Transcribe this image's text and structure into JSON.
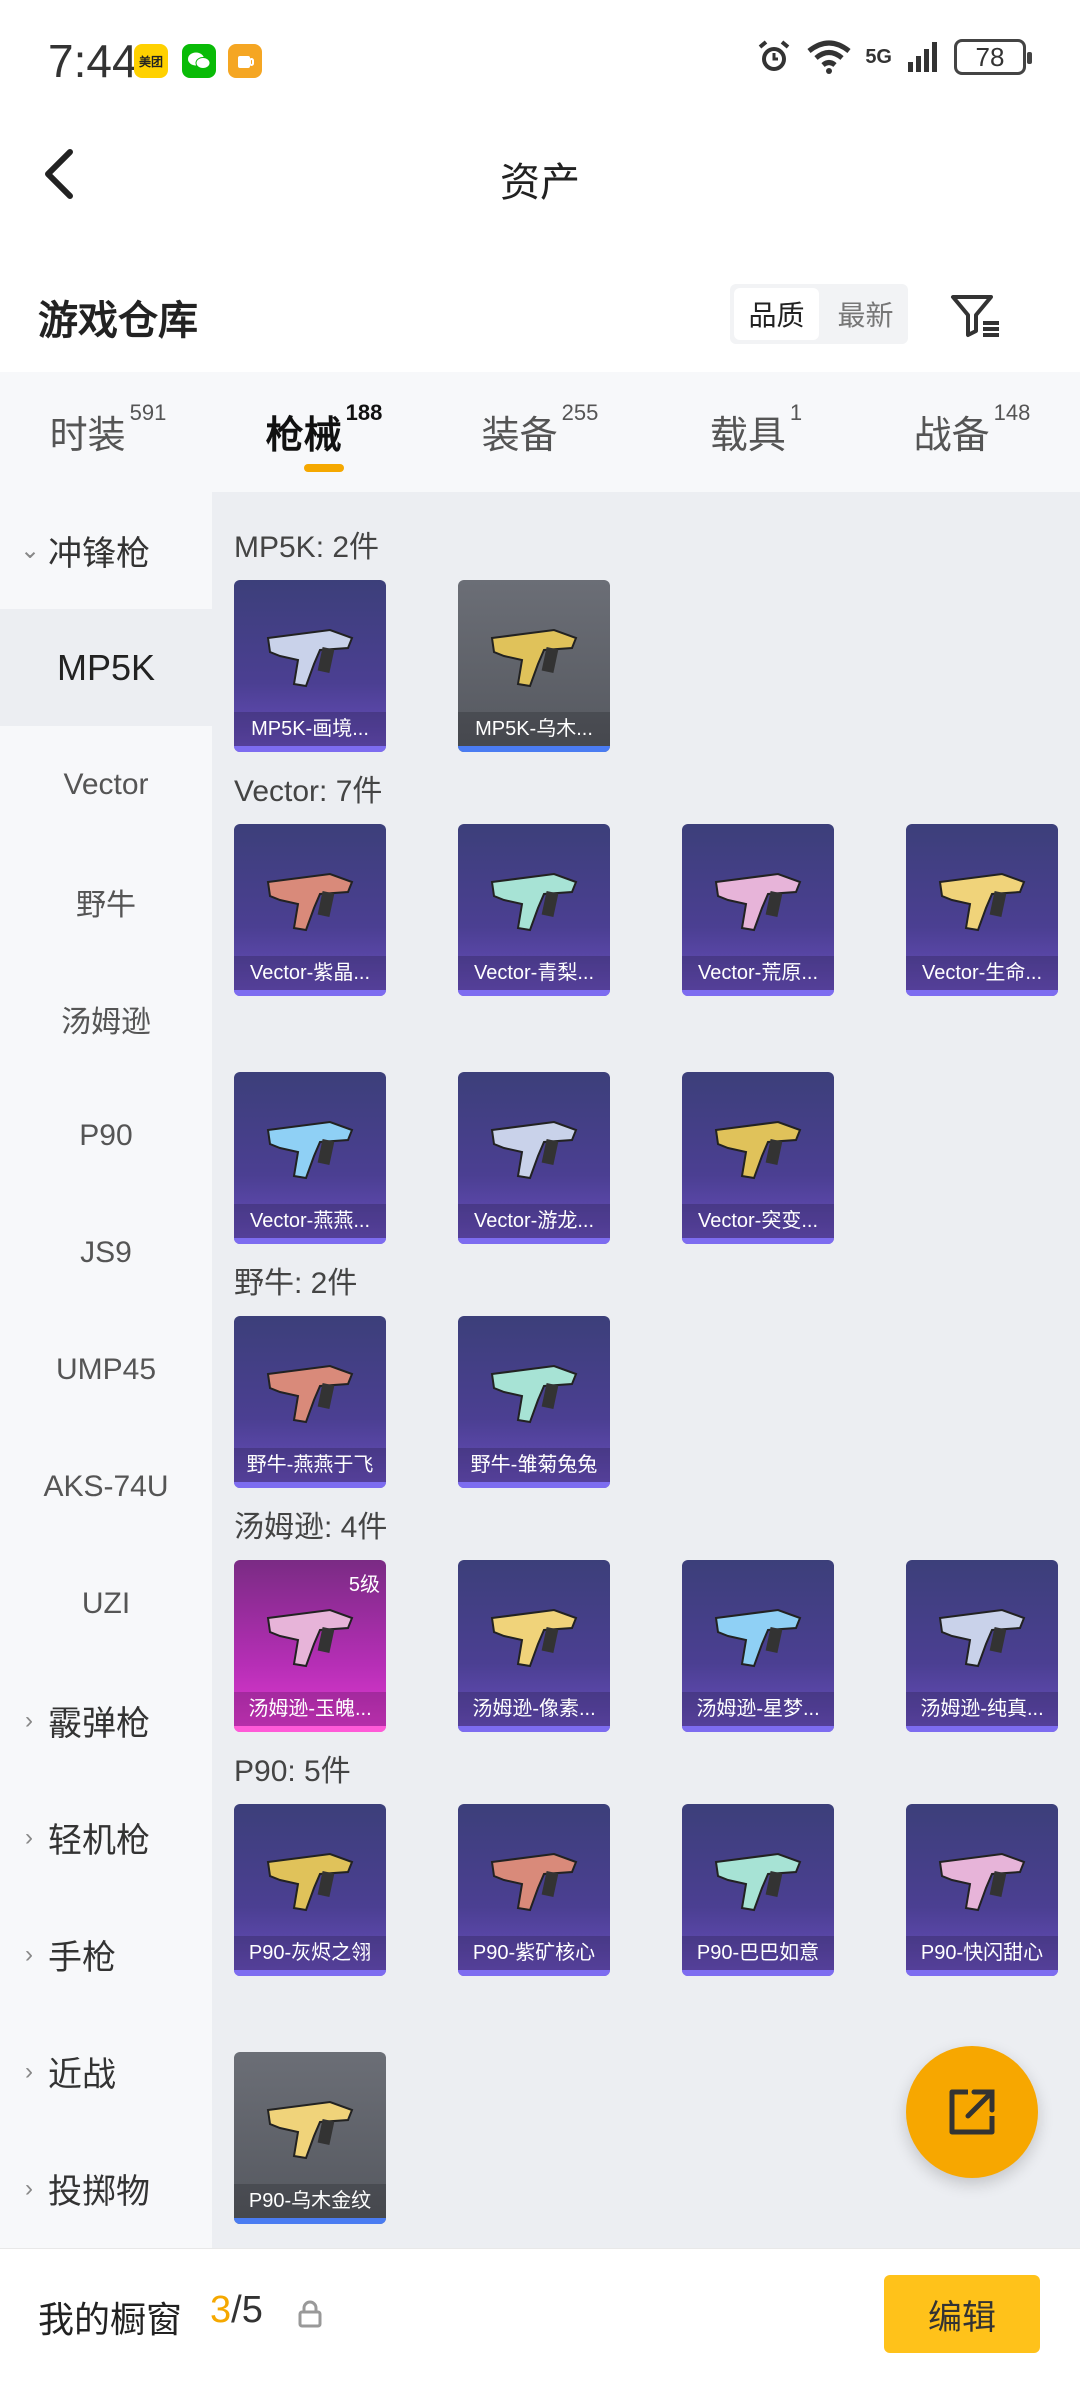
{
  "status_bar": {
    "time": "7:44",
    "apps": [
      "美团",
      "微信",
      "饮"
    ],
    "network": "5G",
    "battery": "78"
  },
  "header": {
    "title": "资产"
  },
  "warehouse": {
    "title": "游戏仓库",
    "sort_options": [
      "品质",
      "最新"
    ],
    "sort_active": "品质"
  },
  "tabs": [
    {
      "label": "时装",
      "count": "591"
    },
    {
      "label": "枪械",
      "count": "188"
    },
    {
      "label": "装备",
      "count": "255"
    },
    {
      "label": "载具",
      "count": "1"
    },
    {
      "label": "战备",
      "count": "148"
    }
  ],
  "active_tab": "枪械",
  "sidebar": [
    {
      "label": "冲锋枪",
      "type": "group",
      "expanded": true
    },
    {
      "label": "MP5K",
      "type": "item",
      "active": true
    },
    {
      "label": "Vector",
      "type": "item"
    },
    {
      "label": "野牛",
      "type": "item"
    },
    {
      "label": "汤姆逊",
      "type": "item"
    },
    {
      "label": "P90",
      "type": "item"
    },
    {
      "label": "JS9",
      "type": "item"
    },
    {
      "label": "UMP45",
      "type": "item"
    },
    {
      "label": "AKS-74U",
      "type": "item"
    },
    {
      "label": "UZI",
      "type": "item"
    },
    {
      "label": "霰弹枪",
      "type": "group",
      "expanded": false
    },
    {
      "label": "轻机枪",
      "type": "group",
      "expanded": false
    },
    {
      "label": "手枪",
      "type": "group",
      "expanded": false
    },
    {
      "label": "近战",
      "type": "group",
      "expanded": false
    },
    {
      "label": "投掷物",
      "type": "group",
      "expanded": false
    }
  ],
  "sections": [
    {
      "label": "MP5K: 2件",
      "items": [
        {
          "name": "MP5K-画境...",
          "style": "purple"
        },
        {
          "name": "MP5K-乌木...",
          "style": "gray"
        }
      ]
    },
    {
      "label": "Vector: 7件",
      "items": [
        {
          "name": "Vector-紫晶...",
          "style": "purple"
        },
        {
          "name": "Vector-青梨...",
          "style": "purple"
        },
        {
          "name": "Vector-荒原...",
          "style": "purple"
        },
        {
          "name": "Vector-生命...",
          "style": "purple"
        },
        {
          "name": "Vector-燕燕...",
          "style": "purple"
        },
        {
          "name": "Vector-游龙...",
          "style": "purple"
        },
        {
          "name": "Vector-突变...",
          "style": "purple"
        }
      ]
    },
    {
      "label": "野牛: 2件",
      "items": [
        {
          "name": "野牛-燕燕于飞",
          "style": "purple"
        },
        {
          "name": "野牛-雏菊兔兔",
          "style": "purple"
        }
      ]
    },
    {
      "label": "汤姆逊: 4件",
      "items": [
        {
          "name": "汤姆逊-玉魄...",
          "style": "pink",
          "level": "5级"
        },
        {
          "name": "汤姆逊-像素...",
          "style": "purple"
        },
        {
          "name": "汤姆逊-星梦...",
          "style": "purple"
        },
        {
          "name": "汤姆逊-纯真...",
          "style": "purple"
        }
      ]
    },
    {
      "label": "P90: 5件",
      "items": [
        {
          "name": "P90-灰烬之翎",
          "style": "purple"
        },
        {
          "name": "P90-紫矿核心",
          "style": "purple"
        },
        {
          "name": "P90-巴巴如意",
          "style": "purple"
        },
        {
          "name": "P90-快闪甜心",
          "style": "purple"
        },
        {
          "name": "P90-乌木金纹",
          "style": "gray"
        }
      ]
    }
  ],
  "bottom_bar": {
    "showcase_label": "我的橱窗",
    "showcase_current": "3",
    "showcase_total": "/5",
    "edit_label": "编辑"
  },
  "colors": {
    "accent": "#f5a800",
    "card_purple": "#4b3f92",
    "card_gray": "#5f6269",
    "card_pink": "#c230c0"
  }
}
